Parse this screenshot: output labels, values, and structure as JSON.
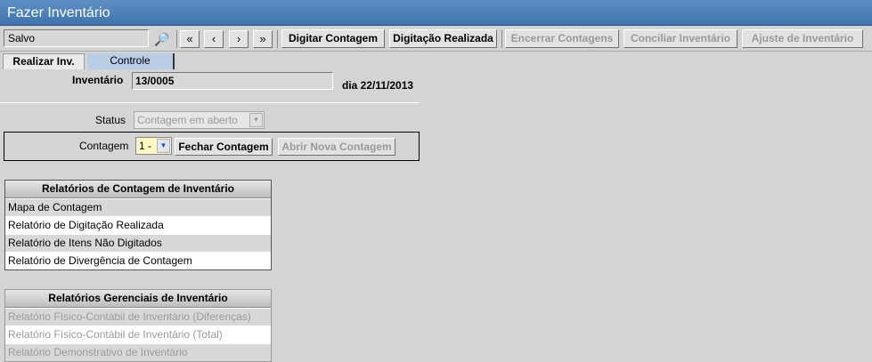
{
  "window": {
    "title": "Fazer Inventário"
  },
  "toolbar": {
    "status_value": "Salvo",
    "binoculars": "binoculars-icon",
    "nav": [
      "«",
      "‹",
      "›",
      "»"
    ],
    "buttons": {
      "digitar_contagem": "Digitar Contagem",
      "digitacao_realizada": "Digitação Realizada",
      "encerrar_contagens": "Encerrar Contagens",
      "conciliar_inventario": "Conciliar Inventário",
      "ajuste_inventario": "Ajuste de Inventário"
    }
  },
  "tabs": {
    "realizar": "Realizar Inv.",
    "controle": "Controle"
  },
  "form": {
    "inventario_label": "Inventário",
    "inventario_value": "13/0005",
    "dia_label": "dia 22/11/2013",
    "status_label": "Status",
    "status_value": "Contagem em aberto",
    "contagem_label": "Contagem",
    "contagem_value": "1 -",
    "fechar_contagem": "Fechar Contagem",
    "abrir_nova_contagem": "Abrir Nova Contagem"
  },
  "relatorios_contagem": {
    "header": "Relatórios de Contagem de Inventário",
    "items": [
      "Mapa de Contagem",
      "Relatório de Digitação Realizada",
      "Relatório de Itens Não Digitados",
      "Relatório de Divergência de Contagem"
    ]
  },
  "relatorios_gerenciais": {
    "header": "Relatórios Gerenciais de Inventário",
    "items": [
      "Relatório Físico-Contábil de Inventário (Diferenças)",
      "Relatório Físico-Contábil de Inventário (Total)",
      "Relatório Demonstrativo de Inventário"
    ]
  },
  "colors": {
    "title_bar": "#4a7fb9",
    "tab_inactive": "#b9cde6",
    "background": "#d4d4d4"
  }
}
